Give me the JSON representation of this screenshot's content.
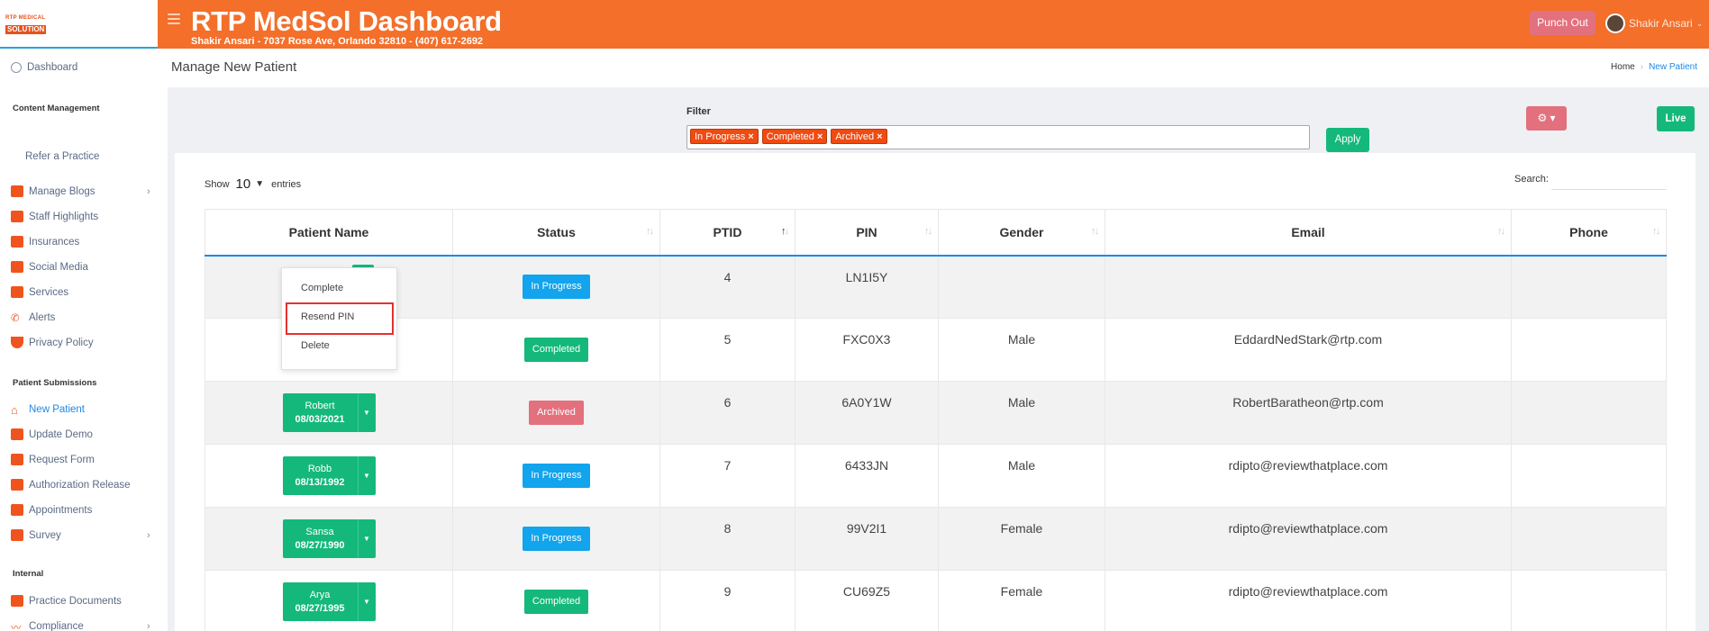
{
  "header": {
    "logo_line1": "RTP MEDICAL",
    "logo_line2": "SOLUTION",
    "title": "RTP MedSol Dashboard",
    "subtitle": "Shakir Ansari - 7037 Rose Ave, Orlando 32810 - (407) 617-2692",
    "punch_label": "Punch Out",
    "user_name": "Shakir Ansari",
    "accent_color": "#f36f2a"
  },
  "sidebar": {
    "dashboard": "Dashboard",
    "sections": {
      "content": "Content Management",
      "patient": "Patient Submissions",
      "internal": "Internal"
    },
    "refer": "Refer a Practice",
    "items": {
      "blogs": "Manage Blogs",
      "staff": "Staff Highlights",
      "insurances": "Insurances",
      "social": "Social Media",
      "services": "Services",
      "alerts": "Alerts",
      "privacy": "Privacy Policy",
      "new_patient": "New Patient",
      "update_demo": "Update Demo",
      "request_form": "Request Form",
      "auth_release": "Authorization Release",
      "appointments": "Appointments",
      "survey": "Survey",
      "practice_docs": "Practice Documents",
      "compliance": "Compliance"
    }
  },
  "page": {
    "title": "Manage New Patient",
    "breadcrumb_home": "Home",
    "breadcrumb_current": "New Patient"
  },
  "filter": {
    "label": "Filter",
    "tags": [
      "In Progress",
      "Completed",
      "Archived"
    ],
    "remove_glyph": "×",
    "apply_label": "Apply",
    "gear_label": "⚙ ▾",
    "live_label": "Live"
  },
  "table_controls": {
    "show_label": "Show",
    "entries_value": "10",
    "entries_label": "entries",
    "search_label": "Search:"
  },
  "table": {
    "columns": [
      "Patient Name",
      "Status",
      "PTID",
      "PIN",
      "Gender",
      "Email",
      "Phone"
    ],
    "rows": [
      {
        "name": "",
        "dob": "",
        "status": "In Progress",
        "ptid": "4",
        "pin": "LN1I5Y",
        "gender": "",
        "email": "",
        "phone": ""
      },
      {
        "name": "",
        "dob": "",
        "status": "Completed",
        "ptid": "5",
        "pin": "FXC0X3",
        "gender": "Male",
        "email": "EddardNedStark@rtp.com",
        "phone": ""
      },
      {
        "name": "Robert",
        "dob": "08/03/2021",
        "status": "Archived",
        "ptid": "6",
        "pin": "6A0Y1W",
        "gender": "Male",
        "email": "RobertBaratheon@rtp.com",
        "phone": ""
      },
      {
        "name": "Robb",
        "dob": "08/13/1992",
        "status": "In Progress",
        "ptid": "7",
        "pin": "6433JN",
        "gender": "Male",
        "email": "rdipto@reviewthatplace.com",
        "phone": ""
      },
      {
        "name": "Sansa",
        "dob": "08/27/1990",
        "status": "In Progress",
        "ptid": "8",
        "pin": "99V2I1",
        "gender": "Female",
        "email": "rdipto@reviewthatplace.com",
        "phone": ""
      },
      {
        "name": "Arya",
        "dob": "08/27/1995",
        "status": "Completed",
        "ptid": "9",
        "pin": "CU69Z5",
        "gender": "Female",
        "email": "rdipto@reviewthatplace.com",
        "phone": ""
      }
    ]
  },
  "row_menu": {
    "items": [
      "Complete",
      "Resend PIN",
      "Delete"
    ],
    "highlighted": "Resend PIN"
  },
  "colors": {
    "green": "#14b87b",
    "blue": "#12a4ec",
    "pink": "#e3707d",
    "tag": "#ef4b12"
  }
}
